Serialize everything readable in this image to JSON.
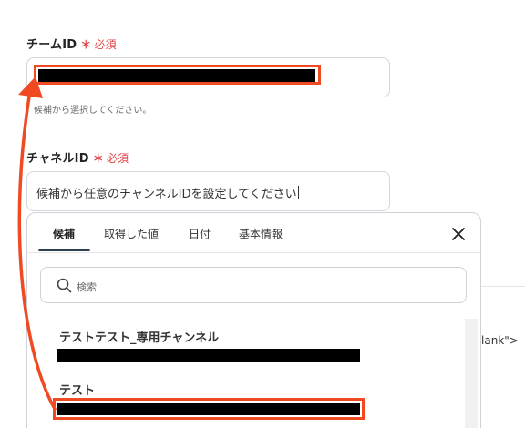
{
  "team_field": {
    "label": "チームID",
    "required_star": "＊",
    "required_text": "必須",
    "hint": "候補から選択してください。"
  },
  "channel_field": {
    "label": "チャネルID",
    "required_star": "＊",
    "required_text": "必須",
    "value": "候補から任意のチャンネルIDを設定してください"
  },
  "picker": {
    "tabs": [
      {
        "label": "候補",
        "active": true
      },
      {
        "label": "取得した値",
        "active": false
      },
      {
        "label": "日付",
        "active": false
      },
      {
        "label": "基本情報",
        "active": false
      }
    ],
    "close_icon": "close-icon",
    "search": {
      "icon": "search-icon",
      "placeholder": "検索"
    },
    "items": [
      {
        "title": "テストテスト_専用チャンネル"
      },
      {
        "title": "テスト"
      }
    ]
  },
  "background_snippet": "lank\">",
  "colors": {
    "required": "#e0464a",
    "annotation": "#f04a23",
    "tab_underline": "#2c3e50"
  }
}
